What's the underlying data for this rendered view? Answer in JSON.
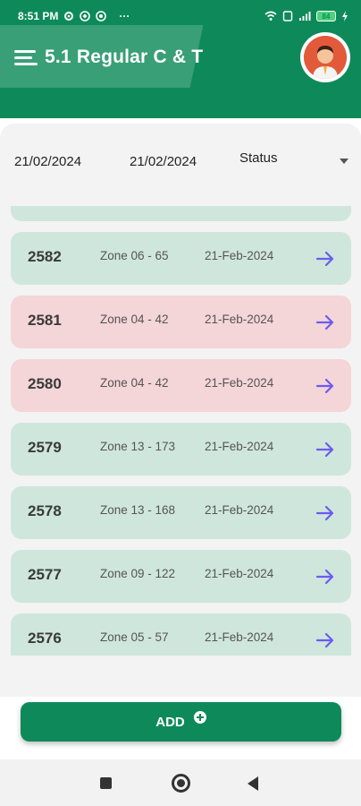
{
  "status_bar": {
    "time": "8:51 PM",
    "more": "···",
    "battery": "84"
  },
  "app_bar": {
    "title": "5.1 Regular C & T"
  },
  "filters": {
    "from_date": "21/02/2024",
    "to_date": "21/02/2024",
    "status_label": "Status"
  },
  "rows": [
    {
      "number": "2582",
      "zone": "Zone 06 - 65",
      "date": "21-Feb-2024",
      "status_color": "#cfe6dc"
    },
    {
      "number": "2581",
      "zone": "Zone 04 - 42",
      "date": "21-Feb-2024",
      "status_color": "#f4d5d8"
    },
    {
      "number": "2580",
      "zone": "Zone 04 - 42",
      "date": "21-Feb-2024",
      "status_color": "#f4d5d8"
    },
    {
      "number": "2579",
      "zone": "Zone 13 - 173",
      "date": "21-Feb-2024",
      "status_color": "#cfe6dc"
    },
    {
      "number": "2578",
      "zone": "Zone 13 - 168",
      "date": "21-Feb-2024",
      "status_color": "#cfe6dc"
    },
    {
      "number": "2577",
      "zone": "Zone 09 - 122",
      "date": "21-Feb-2024",
      "status_color": "#cfe6dc"
    },
    {
      "number": "2576",
      "zone": "Zone 05 - 57",
      "date": "21-Feb-2024",
      "status_color": "#cfe6dc"
    }
  ],
  "add_button": {
    "label": "ADD"
  },
  "colors": {
    "brand": "#0e8a5a",
    "arrow": "#6b5cf0"
  }
}
